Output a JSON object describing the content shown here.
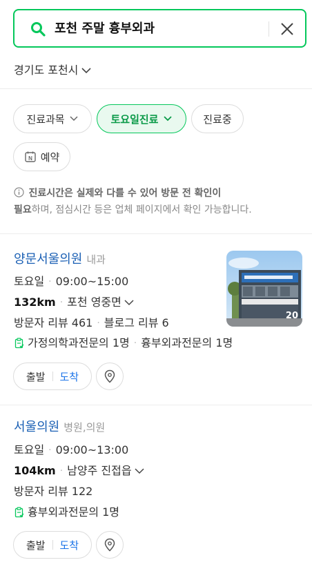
{
  "search": {
    "query": "포천 주말 흉부외과"
  },
  "region": {
    "label": "경기도 포천시"
  },
  "filters": [
    {
      "label": "진료과목"
    },
    {
      "label": "토요일진료"
    },
    {
      "label": "진료중"
    },
    {
      "label": "예약"
    }
  ],
  "notice": {
    "bold1": "진료시간은 실제와 다를 수 있어 방문 전 확인이",
    "bold2": "필요",
    "rest": "하며, 점심시간 등은 업체 페이지에서 확인 가능합니다."
  },
  "results": [
    {
      "name": "양문서울의원",
      "category": "내과",
      "day": "토요일",
      "hours": "09:00~15:00",
      "distance": "132km",
      "location": "포천 영중면",
      "reviews_visitor": "방문자 리뷰 461",
      "reviews_blog": "블로그 리뷰 6",
      "specialists1": "가정의학과전문의 1명",
      "specialists2": "흉부외과전문의 1명",
      "photo_count": "20",
      "depart": "출발",
      "arrive": "도착"
    },
    {
      "name": "서울의원",
      "category": "병원,의원",
      "day": "토요일",
      "hours": "09:00~13:00",
      "distance": "104km",
      "location": "남양주 진접읍",
      "reviews_visitor": "방문자 리뷰 122",
      "specialists1": "흉부외과전문의 1명",
      "depart": "출발",
      "arrive": "도착"
    }
  ],
  "colors": {
    "accent": "#03c75a",
    "link": "#1a5fb4",
    "arrive": "#1a73e8"
  }
}
